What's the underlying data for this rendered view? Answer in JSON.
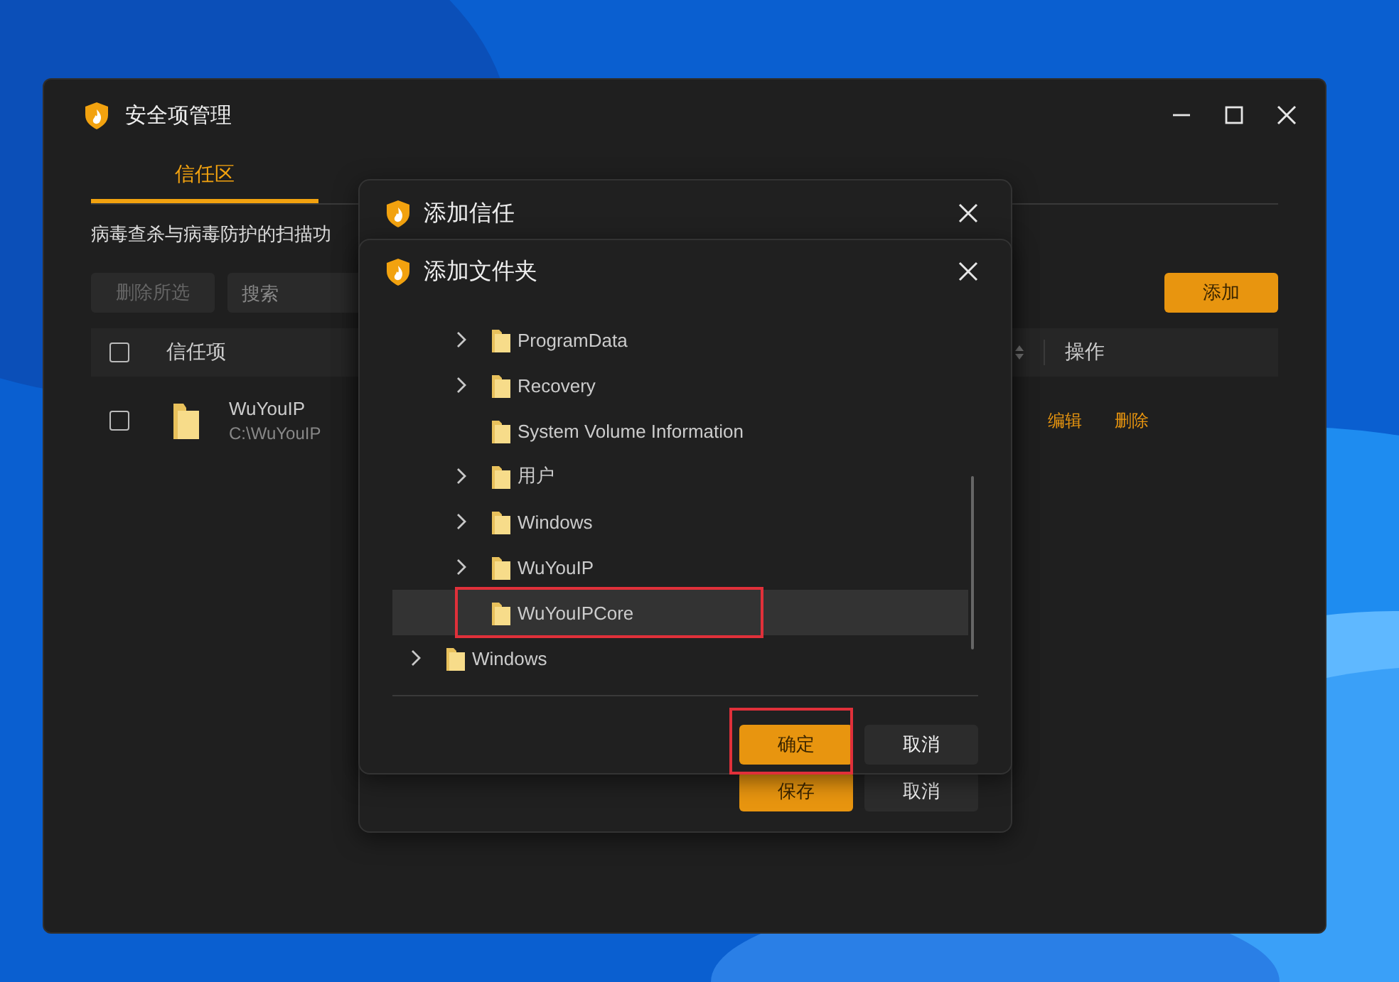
{
  "window": {
    "title": "安全项管理"
  },
  "tabs": [
    {
      "label": "信任区",
      "selected": true
    }
  ],
  "description": "病毒查杀与病毒防护的扫描功",
  "toolbar": {
    "delete_selected": {
      "label": "删除所选",
      "disabled": true
    },
    "search": {
      "placeholder": "搜索"
    },
    "add": {
      "label": "添加"
    }
  },
  "table": {
    "all_checked": false,
    "columns": [
      "信任项",
      "操作"
    ],
    "rows": [
      {
        "checked": false,
        "name": "WuYouIP",
        "path": "C:\\WuYouIP",
        "actions": [
          "编辑",
          "删除"
        ]
      }
    ]
  },
  "dialog_add_trust": {
    "title": "添加信任",
    "buttons": [
      {
        "label": "保存",
        "kind": "primary"
      },
      {
        "label": "取消",
        "kind": "secondary"
      }
    ]
  },
  "dialog_add_folder": {
    "title": "添加文件夹",
    "tree": [
      {
        "children": [
          {
            "label": "ProgramData",
            "has_children": true,
            "selected": false,
            "highlighted": false
          },
          {
            "label": "Recovery",
            "has_children": true,
            "selected": false,
            "highlighted": false
          },
          {
            "label": "System Volume Information",
            "has_children": false,
            "selected": false,
            "highlighted": false
          },
          {
            "label": "用户",
            "has_children": true,
            "selected": false,
            "highlighted": false
          },
          {
            "label": "Windows",
            "has_children": true,
            "selected": false,
            "highlighted": false
          },
          {
            "label": "WuYouIP",
            "has_children": true,
            "selected": false,
            "highlighted": false
          },
          {
            "label": "WuYouIPCore",
            "has_children": false,
            "selected": true,
            "highlighted": true
          }
        ]
      },
      {
        "label": "Windows",
        "has_children": true,
        "selected": false,
        "highlighted": false
      }
    ],
    "buttons": [
      {
        "label": "确定",
        "kind": "primary",
        "highlighted": true
      },
      {
        "label": "取消",
        "kind": "secondary",
        "highlighted": false
      }
    ]
  }
}
